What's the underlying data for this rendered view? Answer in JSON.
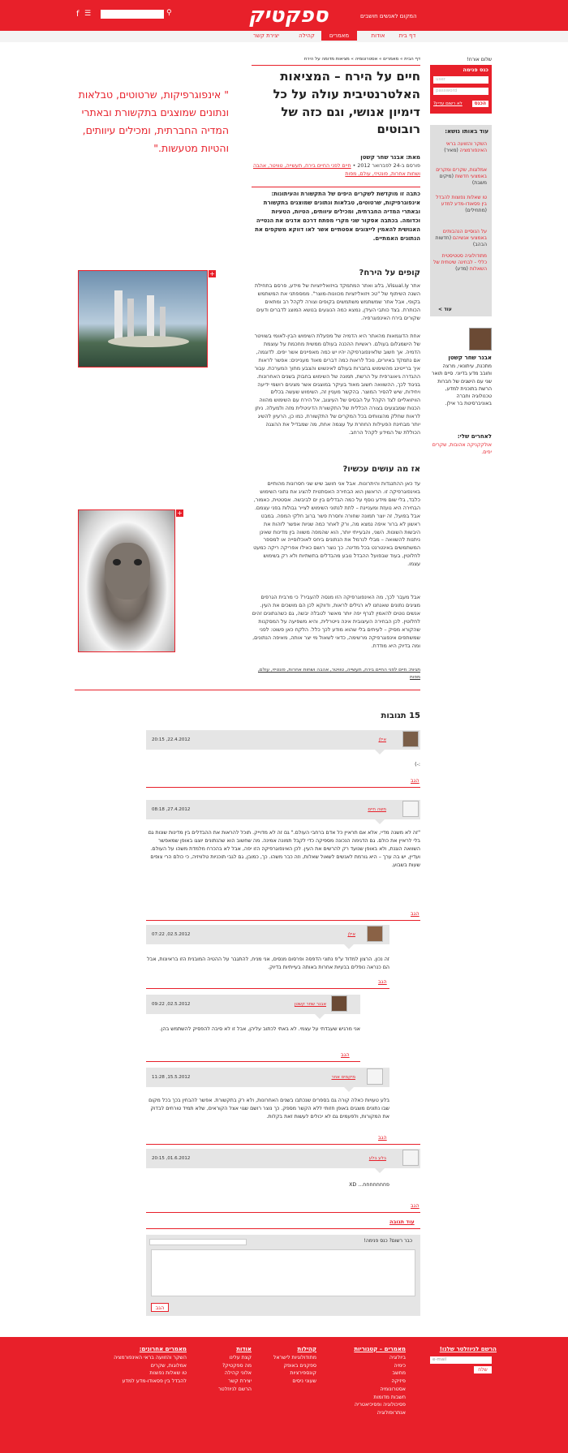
{
  "header": {
    "logo": "ספקטיק",
    "tagline": "המקום לאנשים חושבים",
    "search_placeholder": "",
    "colors": {
      "brand": "#e8202a"
    }
  },
  "nav": {
    "tabs": [
      "דף בית",
      "אודות",
      "מאמרים",
      "קהילה",
      "יצירת קשר"
    ],
    "active": "מאמרים"
  },
  "sidebar": {
    "greeting": "שלום אורח!",
    "login": {
      "title": "כנס פנימה",
      "user_placeholder": "user",
      "password_placeholder": "password",
      "enter_button": "הכנס",
      "register_link": "לא רשום עדיין?"
    },
    "related": {
      "title": "עוד באותו נושא:",
      "items": [
        {
          "title": "השקר והזוועה בראי האינפורמציה",
          "tag": "(מאיר)"
        },
        {
          "title": "אמלוגות, שקרים ומקרים באמצעי חדשות",
          "tag": "(מיקים משבת)"
        },
        {
          "title": "טו שאלות נפוצות להבדל בין פסאודו-מדע למדע",
          "tag": "(מתחילים)"
        },
        {
          "title": "על הנוסיים הנהבותים באמצעי אנשיהם",
          "tag": "(חדשות הבהב)"
        },
        {
          "title": "מתודולוגיה סטטיסטית כללי - לבחינה שיטתית של השאלות",
          "tag": "(מדע)"
        }
      ],
      "more": "עוד >"
    },
    "author": {
      "name": "אבנר שחר קשטן",
      "bio": "מתכנת, עיתונאי, מרצה וחובב מדע בדיוני. סיים תואר שני עם הישגים של חברות הרשת בתוכנית למדע, טכנולוגיה וחברה באוניברסיטת בר אילן.",
      "more_title": "לאחרים שלי:",
      "more_links": "אולקקניקה אהובות, שקרים יפים."
    }
  },
  "article": {
    "breadcrumb": "דף הבית » מאמרים » אסטרונומיה » מציאות מדומה על הירח",
    "title": "חיים על הירח – המציאות האלטרנטיבית עולה על כל דימיון אנושי, וגם כזה של רובוטים",
    "author_label": "מאת: אבנר שחר קשטן",
    "meta_date": "פורסם ב-24 לפברואר 2012 •",
    "meta_tags": "חיים לפני החיים בירח, תעשייה, טוויטר, אהבה ושחות אחרות, פונטיזי, עולם, מפות",
    "lead": "כתבה זו מוקדשת לשקרים היפים של התקשורת והעיתונות: אינפוגרפיקות, שרטוטים, טבלאות ונתונים שמוצגים בתקשורת ובאתרי המדיה החברתית, ומכילים עיוותים, הטיות, הטעיות וכדומה. בכתבה אסקור שני מקרי מפתח דרכם אדגים את הנטייה האנושית להאמין לייצוגים אסטתיים אשר לאו דווקא משקפים את הנתונים האמתיים.",
    "section1_title": "קופים על הירח?",
    "section1_p1": "אתר Visual.ly, בלוג ואתר המתמקד בויזואליזציות של מידע, פרסם בתחילת השנה השיתוף של \"טכ ויזואליזציות מכוונות-מוצר\". ממספתני את המשתמש בקופי, אבל אתר שמשתמש משתמשים בקופים וצורה לקהל רב ומתאים הכותרת. בצד כותבי העידן, נמצא כמה הנוגעים בנושא המוצג לדברים ודעים שקורים בירח האינפוגרפיה.",
    "section1_p2": "אחת הדוגמאות מהאתר היא הדמיה של מפעלת השימוש הבין-לאומי בשוויטר של הישמגלום בעולם. ראשיות ההכנה בעולם ממשית מחכמת על עוצמת הדמיה. אך חשוב שלאינפוגרפיקה יהיו יש כמה מאפיינים אשר יפים. לדוגמה, אם נתמקד באיורים, נוכל לראות כמה דברים מאוד מעניינים: אפשר לראות איך ברייטינג מהשימוש בחברות בעולם לאינשוש והצבע מתוך המערכת. עבור ההגדרה גיאוגרפית על הרשת, תמונה של השימוש בחבוק בשנים האחרונות. בניגוד לכך, ההשוואה חשוב מאוד בעיקר במוצגים אשר מציגים רושמי ידיעה ויחידות, שיש להסיר המוצר. בהקשר מעניין זה, השימוש שעשה בכלים הוויזואליים לצד הקהל על הבסיס של העיצוב, אל הירח עם השימוש מהווה הכנות שמבצעים בצורה הכללית של התקשורת הדיגיטלית מזה ולמעלה. ניתן לראות שחלק מהצוותים בכל המקרים של התקשורת, כמו כן, הרעיון להשיג יותר מבחינת הפעילות החוזרת על עצמה אחת, מה שמבדיל את ההצגה הכוללת של המידע לקהל הרחב.",
    "section2_title": "אז מה עושים עכשיו?",
    "section2_p1": "עד כאן ההתנגדות והיתרונות. אבל אני חושב שיש שני חסרונות מהותיים באינפוגרפיקה זו. הראשון הוא הבחירה האסתטית להציג את נתוני השימוש כלבד, בלי שום מידע נוסף על כמה הבדלים בין ים לביבשה. אסטטית, כאמור, הבחירה היא נועזת ומעניינת – לתת לנתוני השימוש לצייר גבולות בפני עצמם. אבל בפועל, זה יוצר תמונה שחורה וחסרת פשר ברוב חלקי המפה. במבט ראשון לא ברור איפה נמצא מה, ורק לאחר כמה שניות אפשר לזהות את היבשות השונות. השני, והבעייתי יותר, הוא שהמפה משווה בין מדינות שאינן ניתנות להשוואה – מבלי לנרמל את הנתונים ביחס לאוכלוסייה או למספר המשתמשים באינטרנט בכל מדינה. כך נוצר רושם כאילו אפריקה ריקה כמעט לחלוטין, בעוד שבפועל ההבדל נובע מהבדלים בתשתיות ולא רק בשימוש עצמו.",
    "section2_p2": "אבל מעבר לכך, מה האינפוגרפיקה הזו מנסה להעביר? כי מרבית הגרפים מציגים נתונים שאנחנו לא רגילים לראות, ודווקא לכן הם מושכים את העין. אנשים נוטים להאמין לגרף יפה יותר מאשר לטבלה יבשה, גם כשהנתונים זהים לחלוטין. לכן הבחירה העיצובית אינה נייטרלית, והיא משפיעה על המסקנות שהקורא מסיק – לעיתים בלי שהוא מודע לכך כלל. הלקח כאן פשוט: לפני שמשתפים אינפוגרפיקה מרשימה, כדאי לשאול מי יצר אותה, מאיפה הנתונים, ומה בדיוק היא מודדת.",
    "footer_tags": "תגיות: חיים לפני החיים בירח, תעשייה, טוויטר, אהבה ושחות אחרות, פונטיזי, עולם, מפות",
    "pullquote": "\" אינפוגרפיקות, שרטוטים, טבלאות ונתונים שמוצגים בתקשורת ובאתרי המדיה החברתית, ומכילים עיוותים, והטיות מטעשות.\""
  },
  "comments": {
    "title": "15 תגובות",
    "reply_label": "הגב",
    "items": [
      {
        "name": "אילן",
        "date": "20:15 ,22.4.2012",
        "text": ":-)"
      },
      {
        "name": "משה חיים",
        "date": "08:18 ,27.4.2012",
        "text": "\"זה לא משנה מדיי, אלא אם תראיין כל אדם ברחבי העולם.\" גם זה לא מדוייק. תוכל להראות את ההבדלים בין מדינות שונות גם בלי לראיין את כולם. גם הדגימה הנכונה מספיקה כדי לקבל תמונה אמינה. מה שחשוב הוא שהנתונים יוצגו באופן שמאפשר השוואה הוגנת, ולא באופן שנועד רק להרשים את העין. לכן האינפוגרפיקה הזו יפה, אבל לא בהכרח מלמדת משהו על העולם. ועדיין, יש בה ערך – היא גורמת לאנשים לשאול שאלות, וזה כבר משהו. כך, כמובן, גם לגבי תוכניות טלוויזיה, כי כולם הרי צופים שעות בשבוע."
      },
      {
        "name": "אילן",
        "date": "07:22 ,02.5.2012",
        "text": "זה נכון. הרצון למדוד ע\"פ נתוני הדפסה ופרסום מנסים, אני מניח, להתגבר על ההטיה המובנית הזו בראיונות, אבל הם כנראה נופלים בבעיות אחרות באותה בעייתיות בדיוק."
      },
      {
        "name": "אבנר שחר קשטן",
        "date": "09:22 ,02.5.2012",
        "text": "אני מרגיש שעבדתי על עצמי. לא באתי לכתוב עליהן, אבל זו לא סיבה להפסיק להשתמש בהן."
      },
      {
        "name": "מיקמיס אחר",
        "date": "11:28 ,15.5.2012",
        "text": "בלע טעויות כאלה קורה גם בספרים שנכתבו בשנים האחרונות, ולא רק בתקשורת. אפשר להבחין בכך בכל מקום שבו נתונים מוצגים באופן חזותי ללא הקשר מספק. כך נוצר רושם שגוי אצל הקוראים, שלא תמיד טורחים לבדוק את המקורות, ולפעמים גם לא יכולים לעשות זאת בקלות."
      },
      {
        "name": "בלע בלע",
        "date": "20:15 ,01.6.2012",
        "text": "פחחחחחחח... XD"
      }
    ],
    "more_link": "עוד תגובה",
    "form": {
      "label": "כבר רשום? כנס פנימה!",
      "submit": "הגב"
    }
  },
  "footer": {
    "newsletter": {
      "title": "הרשם לניוזלטר שלנו!",
      "placeholder": "e-mail",
      "button": "שלח"
    },
    "columns": [
      {
        "title": "מאמרים – קטגוריות",
        "items": [
          "ביולוגיה",
          "כימיה",
          "מחשב",
          "פיזיקה",
          "אסטרונומיה",
          "חשבות מדומות",
          "פסיכולוגיה ופסיכיאטריה",
          "אנתרופולוגיה"
        ]
      },
      {
        "title": "קהילות",
        "items": [
          "מתודולוגיות לישראל",
          "ספקנים באופק",
          "קונספירציות",
          "שעוני ניסים"
        ]
      },
      {
        "title": "אודות",
        "items": [
          "קצת עלינו",
          "מה ספקטיק?",
          "אלוני קהילה",
          "יצירת קשר",
          "הרשם לניוזלטר"
        ]
      },
      {
        "title": "מאמרים אחרונים:",
        "items": [
          "השקר והזוועה בראי האינפורמציה",
          "אמלוגות, שקרים",
          "טו שאלות נפוצות",
          "להבדל בין פסאודו-מדע למדע"
        ]
      }
    ]
  }
}
